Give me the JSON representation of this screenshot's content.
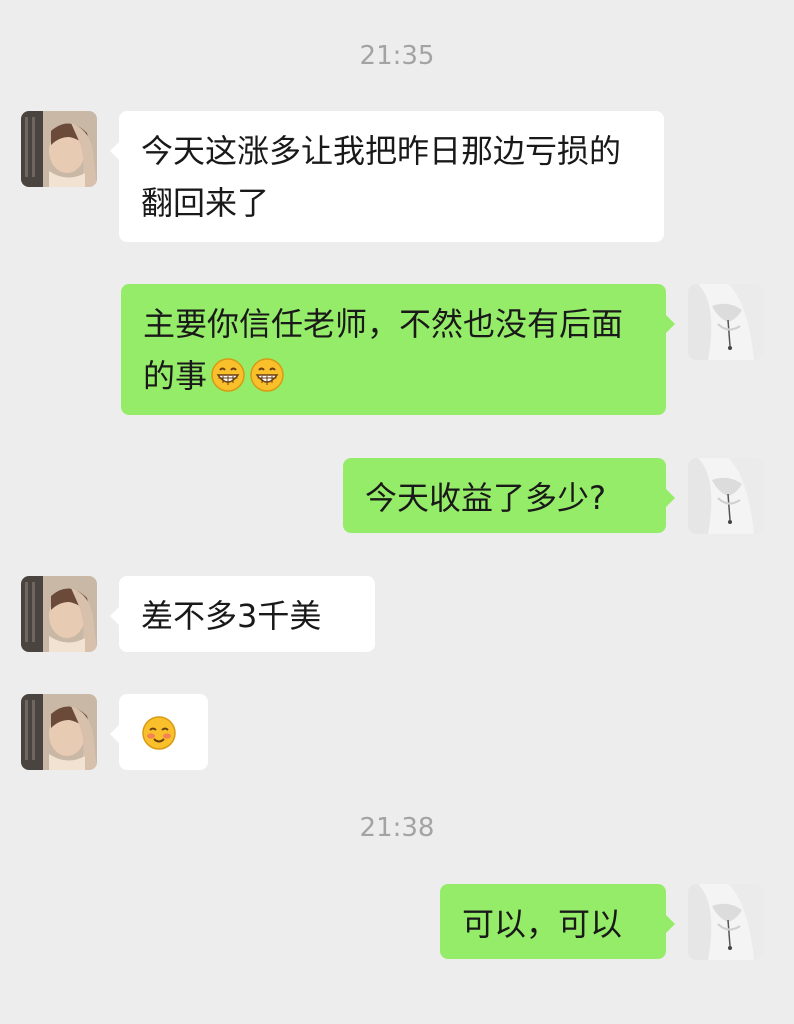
{
  "chat": {
    "timestamp_1": "21:35",
    "timestamp_2": "21:38",
    "messages": [
      {
        "sender": "contact",
        "text": "今天这涨多让我把昨日那边亏损的翻回来了"
      },
      {
        "sender": "self",
        "text": "主要你信任老师，不然也没有后面的事",
        "emojis": [
          "grinning-emoji",
          "grinning-emoji"
        ]
      },
      {
        "sender": "self",
        "text": "今天收益了多少?"
      },
      {
        "sender": "contact",
        "text": "差不多3千美"
      },
      {
        "sender": "contact",
        "text": "",
        "emojis": [
          "blush-emoji"
        ]
      },
      {
        "sender": "self",
        "text": "可以，可以"
      }
    ]
  },
  "colors": {
    "background": "#ededed",
    "incoming_bubble": "#ffffff",
    "outgoing_bubble": "#95ec69",
    "timestamp": "#a3a3a3"
  }
}
